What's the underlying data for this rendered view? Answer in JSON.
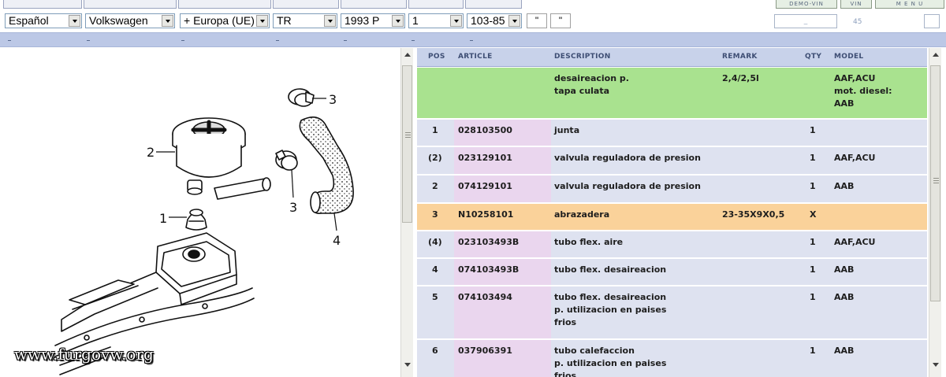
{
  "top_buttons": {
    "demo_vin": "DEMO-VIN",
    "vin": "VIN",
    "menu": "M E N U"
  },
  "selectors": [
    {
      "value": "Español"
    },
    {
      "value": "Volkswagen"
    },
    {
      "value": "+ Europa (UE)"
    },
    {
      "value": "TR"
    },
    {
      "value": "1993 P"
    },
    {
      "value": "1"
    },
    {
      "value": "103-85"
    }
  ],
  "quote_buttons": [
    "\"",
    "\""
  ],
  "search_box": {
    "value": "_"
  },
  "count": "45",
  "watermark": "www.furgovw.org",
  "diagram_callouts": [
    "1",
    "2",
    "3",
    "3",
    "4"
  ],
  "table": {
    "headers": {
      "pos": "POS",
      "article": "ARTICLE",
      "description": "DESCRIPTION",
      "remark": "REMARK",
      "qty": "QTY",
      "model": "MODEL"
    },
    "colors": {
      "header": "#c8d2ea",
      "group_row": "#a9e28f",
      "highlight_row": "#fad29a",
      "normal_row": "#dee2f0",
      "article_col": "#ead6ee"
    },
    "rows": [
      {
        "type": "group",
        "pos": "",
        "article": "",
        "description": "desaireacion p.\ntapa culata",
        "remark": "2,4/2,5l",
        "qty": "",
        "model": "AAF,ACU\nmot. diesel:\nAAB"
      },
      {
        "type": "normal",
        "pos": "1",
        "article": "028103500",
        "description": "junta",
        "remark": "",
        "qty": "1",
        "model": ""
      },
      {
        "type": "normal",
        "pos": "(2)",
        "article": "023129101",
        "description": "valvula reguladora de presion",
        "remark": "",
        "qty": "1",
        "model": "AAF,ACU"
      },
      {
        "type": "normal",
        "pos": "2",
        "article": "074129101",
        "description": "valvula reguladora de presion",
        "remark": "",
        "qty": "1",
        "model": "AAB"
      },
      {
        "type": "highlight",
        "pos": "3",
        "article": "N10258101",
        "description": "abrazadera",
        "remark": "23-35X9X0,5",
        "qty": "X",
        "model": ""
      },
      {
        "type": "normal",
        "pos": "(4)",
        "article": "023103493B",
        "description": "tubo flex. aire",
        "remark": "",
        "qty": "1",
        "model": "AAF,ACU"
      },
      {
        "type": "normal",
        "pos": "4",
        "article": "074103493B",
        "description": "tubo flex. desaireacion",
        "remark": "",
        "qty": "1",
        "model": "AAB"
      },
      {
        "type": "normal",
        "pos": "5",
        "article": "074103494",
        "description": "tubo flex. desaireacion\np. utilizacion en paises\nfrios",
        "remark": "",
        "qty": "1",
        "model": "AAB"
      },
      {
        "type": "normal",
        "pos": "6",
        "article": "037906391",
        "description": "tubo calefaccion\np. utilizacion en paises\nfrios",
        "remark": "",
        "qty": "1",
        "model": "AAB"
      }
    ]
  }
}
